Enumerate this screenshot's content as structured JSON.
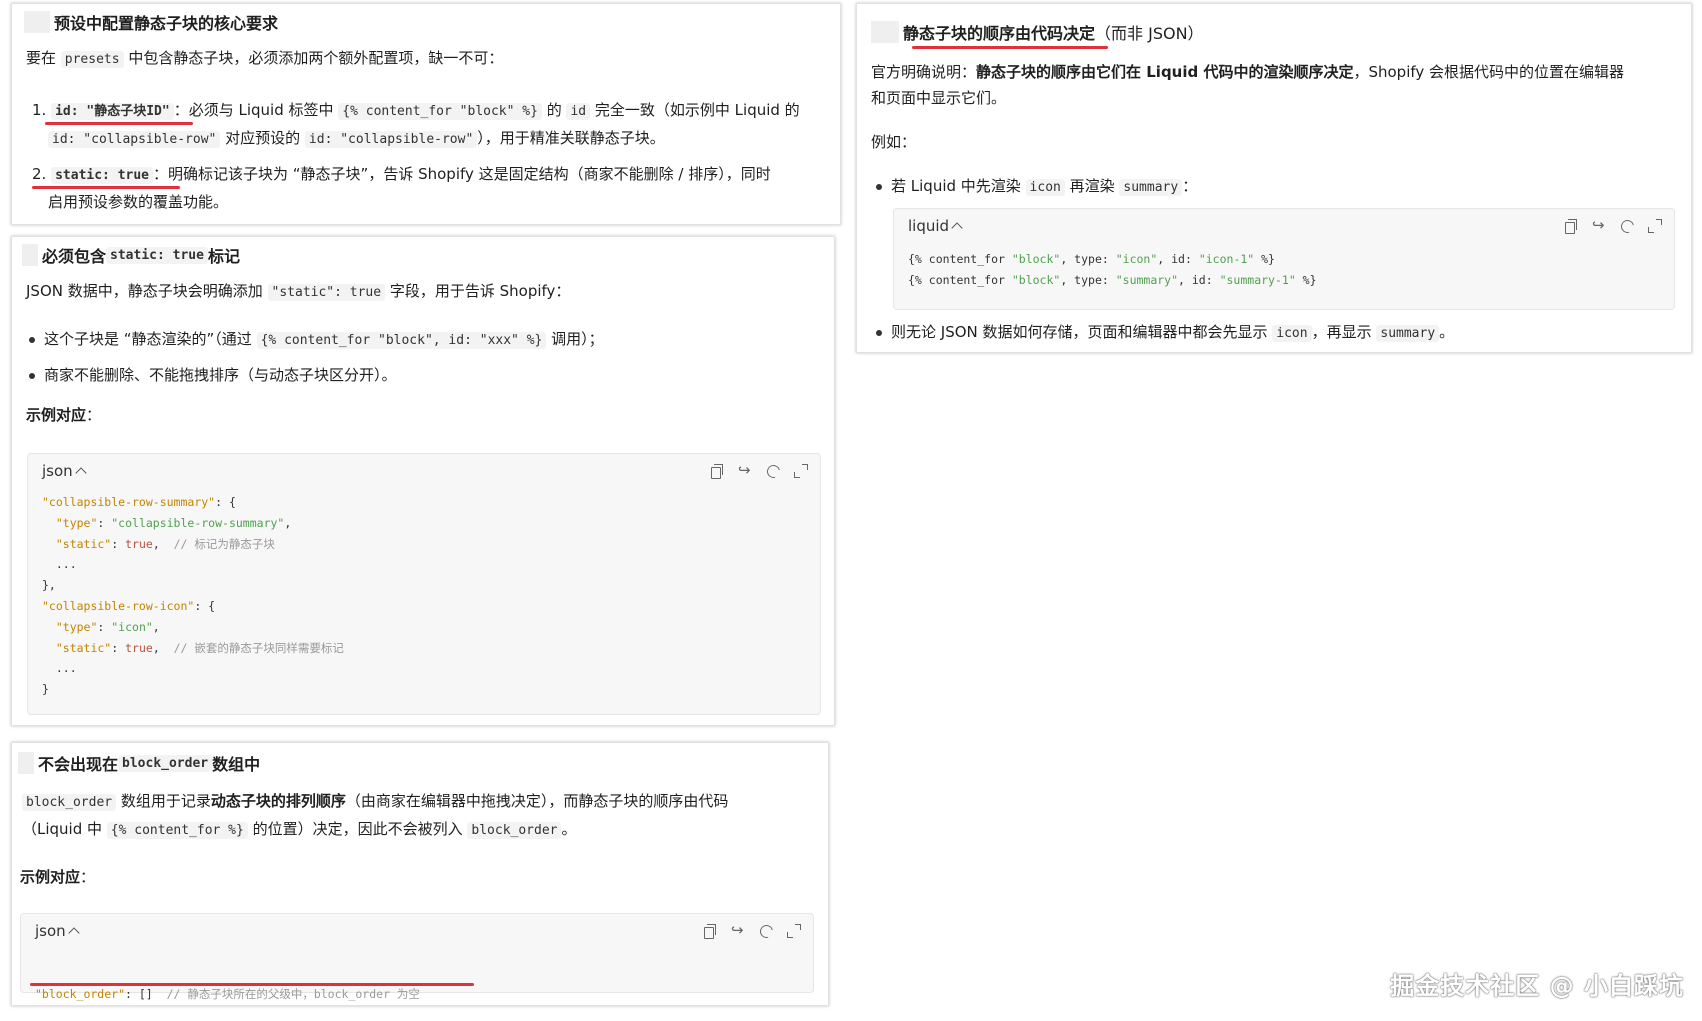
{
  "panel1": {
    "heading": "预设中配置静态子块的核心要求",
    "intro_pre": "要在 ",
    "intro_code": "presets",
    "intro_post": " 中包含静态子块，必须添加两个额外配置项，缺一不可：",
    "item1_num": "1.",
    "item1_code": "id: \"静态子块ID\"",
    "item1_text1": "：必须与 Liquid 标签中 ",
    "item1_code2": "{% content_for \"block\" %}",
    "item1_text2": " 的 ",
    "item1_code3": "id",
    "item1_text3": " 完全一致（如示例中 Liquid 的",
    "item1_code4": "id: \"collapsible-row\"",
    "item1_text4": " 对应预设的 ",
    "item1_code5": "id: \"collapsible-row\"",
    "item1_text5": "），用于精准关联静态子块。",
    "item2_num": "2.",
    "item2_code": "static: true",
    "item2_text1": "：明确标记该子块为 “静态子块”，告诉 Shopify 这是固定结构（商家不能删除 / 排序），同时",
    "item2_text2": "启用预设参数的覆盖功能。"
  },
  "panel2": {
    "heading_pre": "必须包含 ",
    "heading_code": "static: true",
    "heading_post": " 标记",
    "intro_pre": "JSON 数据中，静态子块会明确添加 ",
    "intro_code": "\"static\": true",
    "intro_post": " 字段，用于告诉 Shopify：",
    "bullet1_pre": "这个子块是 “静态渲染的”（通过 ",
    "bullet1_code": "{% content_for \"block\", id: \"xxx\" %}",
    "bullet1_post": " 调用）；",
    "bullet2": "商家不能删除、不能拖拽排序（与动态子块区分开）。",
    "example_label": "示例对应",
    "example_colon": "：",
    "code_lang": "json",
    "code_lines": [
      [
        "\"collapsible-row-summary\"",
        ": {",
        "",
        ""
      ],
      [
        "  \"type\"",
        ": ",
        "\"collapsible-row-summary\"",
        ","
      ],
      [
        "  \"static\"",
        ": ",
        "true",
        ",  // 标记为静态子块"
      ],
      [
        "  ...",
        "",
        "",
        ""
      ],
      [
        "},",
        "",
        "",
        ""
      ],
      [
        "\"collapsible-row-icon\"",
        ": {",
        "",
        ""
      ],
      [
        "  \"type\"",
        ": ",
        "\"icon\"",
        ","
      ],
      [
        "  \"static\"",
        ": ",
        "true",
        ",  // 嵌套的静态子块同样需要标记"
      ],
      [
        "  ...",
        "",
        "",
        ""
      ],
      [
        "}",
        "",
        "",
        ""
      ]
    ]
  },
  "panel3": {
    "heading_pre": "不会出现在 ",
    "heading_code": "block_order",
    "heading_post": " 数组中",
    "line1_code": "block_order",
    "line1_text1": " 数组用于记录",
    "line1_bold": "动态子块的排列顺序",
    "line1_text2": "（由商家在编辑器中拖拽决定），而静态子块的顺序由代码",
    "line2_text1": "（Liquid 中 ",
    "line2_code": "{% content_for %}",
    "line2_text2": " 的位置）决定，因此不会被列入 ",
    "line2_code2": "block_order",
    "line2_text3": "。",
    "example_label": "示例对应",
    "example_colon": "：",
    "code_lang": "json",
    "code_key": "\"block_order\"",
    "code_mid": ": []  ",
    "code_comment": "// 静态子块所在的父级中，block_order 为空"
  },
  "panel4": {
    "heading": "静态子块的顺序由代码决定",
    "heading_post": "（而非 JSON）",
    "line1_pre": "官方明确说明：",
    "line1_bold": "静态子块的顺序由它们在 Liquid 代码中的渲染顺序决定",
    "line1_post": "，Shopify 会根据代码中的位置在编辑器",
    "line2": "和页面中显示它们。",
    "example": "例如：",
    "bullet1_pre": "若 Liquid 中先渲染 ",
    "bullet1_code1": "icon",
    "bullet1_mid": " 再渲染 ",
    "bullet1_code2": "summary",
    "bullet1_post": "：",
    "code_lang": "liquid",
    "code_line1": [
      "{% content_for ",
      "\"block\"",
      ", type: ",
      "\"icon\"",
      ", id: ",
      "\"icon-1\"",
      " %}"
    ],
    "code_line2": [
      "{% content_for ",
      "\"block\"",
      ", type: ",
      "\"summary\"",
      ", id: ",
      "\"summary-1\"",
      " %}"
    ],
    "bullet2_pre": "则无论 JSON 数据如何存储，页面和编辑器中都会先显示 ",
    "bullet2_code1": "icon",
    "bullet2_mid": "，再显示 ",
    "bullet2_code2": "summary",
    "bullet2_post": "。"
  },
  "watermark": "掘金技术社区 @ 小白踩坑",
  "colors": {
    "accent_red": "#e0313b",
    "string_green": "#50a14f",
    "key_orange": "#c18401",
    "comment_gray": "#9a9a9a"
  }
}
